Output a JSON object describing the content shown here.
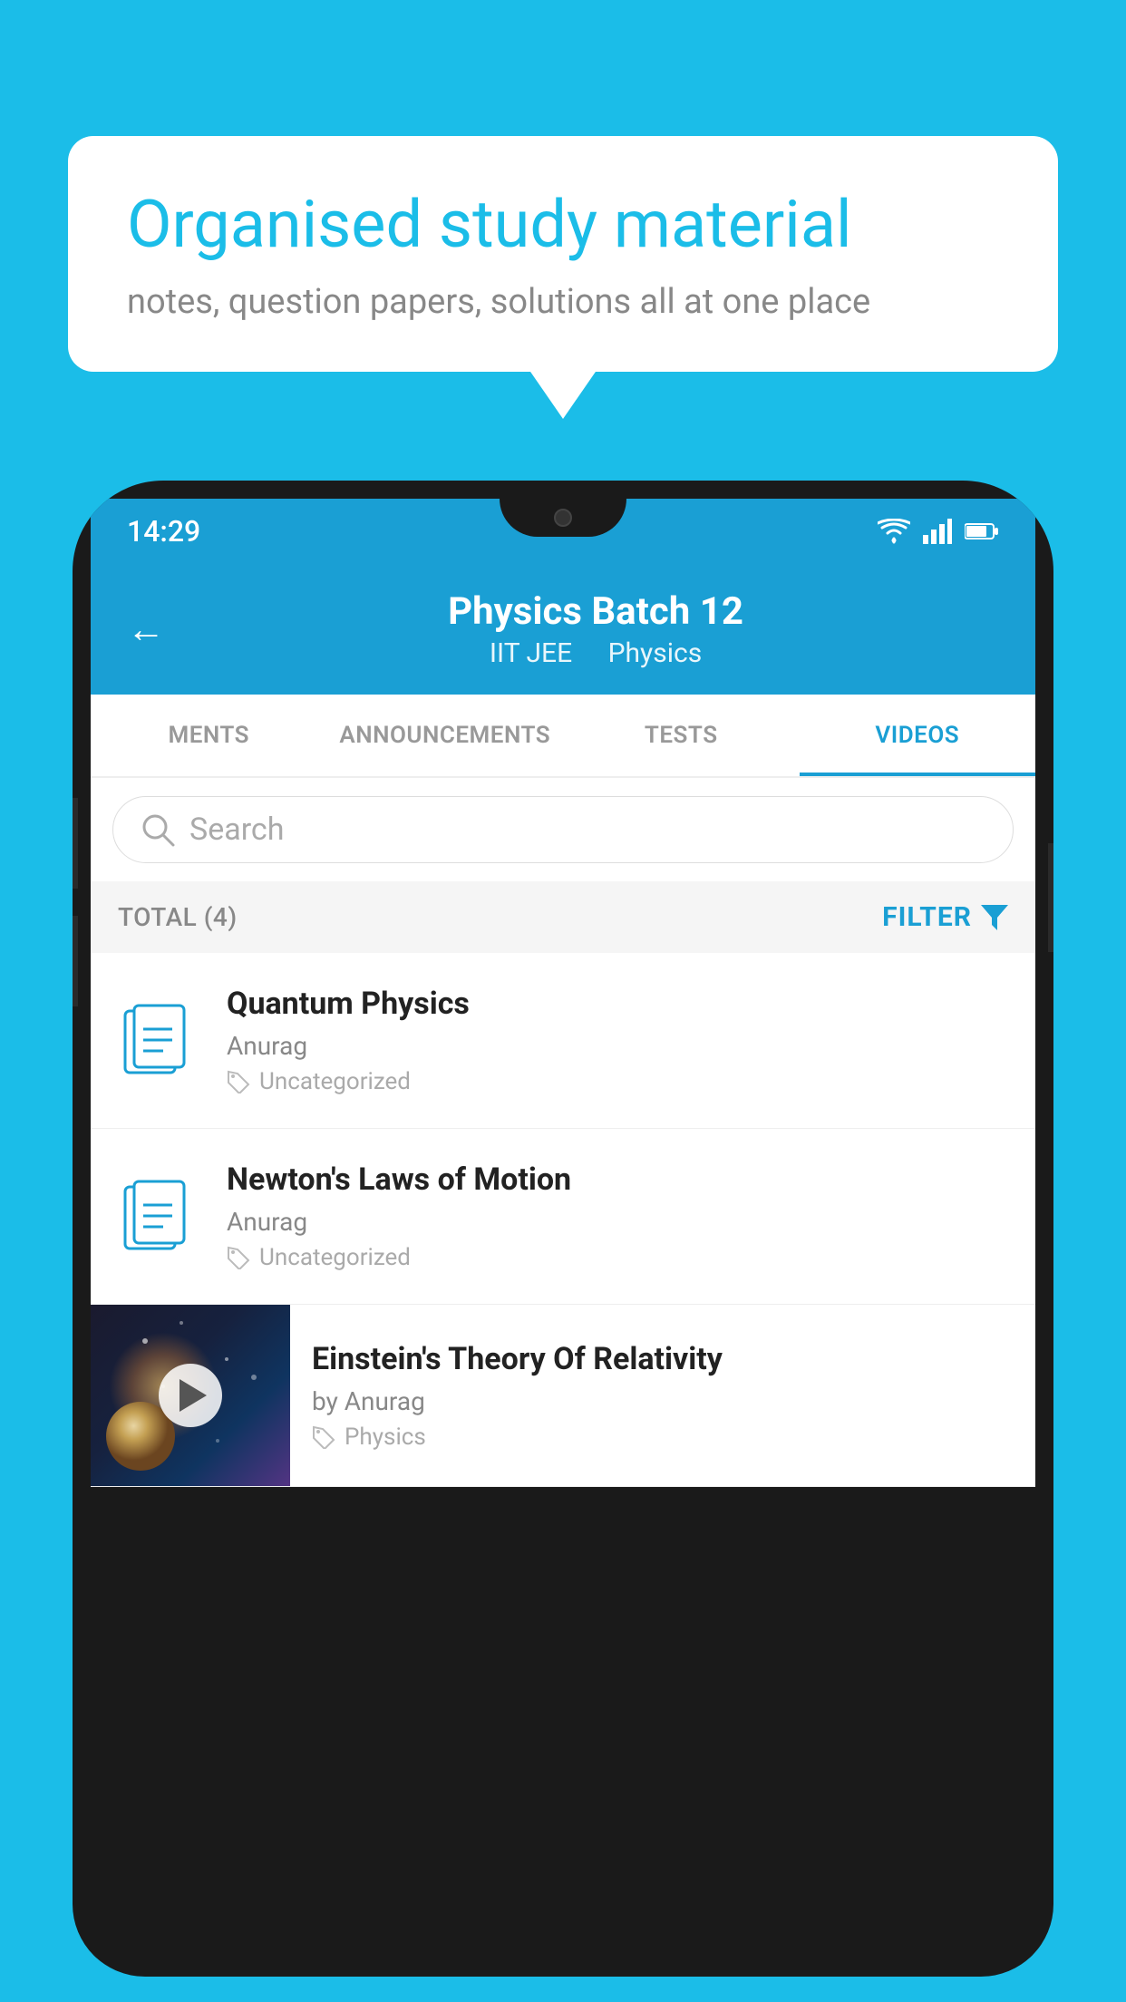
{
  "background_color": "#1bbde8",
  "speech_bubble": {
    "title": "Organised study material",
    "subtitle": "notes, question papers, solutions all at one place"
  },
  "phone": {
    "status_bar": {
      "time": "14:29",
      "icons": [
        "wifi",
        "signal",
        "battery"
      ]
    },
    "header": {
      "back_label": "←",
      "title": "Physics Batch 12",
      "subtitle_part1": "IIT JEE",
      "subtitle_part2": "Physics"
    },
    "tabs": [
      {
        "label": "MENTS",
        "active": false
      },
      {
        "label": "ANNOUNCEMENTS",
        "active": false
      },
      {
        "label": "TESTS",
        "active": false
      },
      {
        "label": "VIDEOS",
        "active": true
      }
    ],
    "search": {
      "placeholder": "Search"
    },
    "filter_row": {
      "total_label": "TOTAL (4)",
      "filter_label": "FILTER"
    },
    "video_items": [
      {
        "title": "Quantum Physics",
        "author": "Anurag",
        "tag": "Uncategorized",
        "has_thumbnail": false
      },
      {
        "title": "Newton's Laws of Motion",
        "author": "Anurag",
        "tag": "Uncategorized",
        "has_thumbnail": false
      },
      {
        "title": "Einstein's Theory Of Relativity",
        "author": "by Anurag",
        "tag": "Physics",
        "has_thumbnail": true
      }
    ]
  }
}
